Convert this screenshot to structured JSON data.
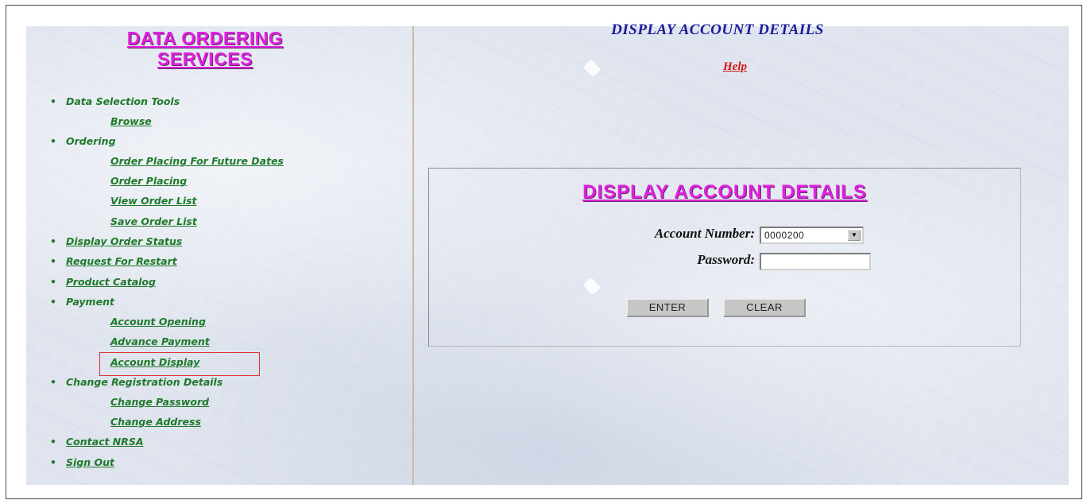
{
  "sidebar": {
    "title": "DATA ORDERING SERVICES",
    "items": [
      {
        "label": "Data Selection Tools",
        "link": false
      },
      {
        "label": "Browse",
        "link": true
      },
      {
        "label": "Ordering",
        "link": false
      },
      {
        "label": "Order Placing For Future Dates",
        "link": true
      },
      {
        "label": "Order Placing",
        "link": true
      },
      {
        "label": "View Order List",
        "link": true
      },
      {
        "label": "Save Order List",
        "link": true
      },
      {
        "label": "Display Order Status",
        "link": true
      },
      {
        "label": "Request For Restart",
        "link": true
      },
      {
        "label": "Product Catalog",
        "link": true
      },
      {
        "label": "Payment",
        "link": false
      },
      {
        "label": "Account Opening",
        "link": true
      },
      {
        "label": "Advance Payment",
        "link": true
      },
      {
        "label": "Account Display",
        "link": true
      },
      {
        "label": "Change Registration Details",
        "link": false
      },
      {
        "label": "Change Password",
        "link": true
      },
      {
        "label": "Change Address",
        "link": true
      },
      {
        "label": "Contact NRSA",
        "link": true
      },
      {
        "label": "Sign Out",
        "link": true
      }
    ],
    "active_item": "Account Display"
  },
  "main": {
    "header": "DISPLAY ACCOUNT DETAILS",
    "help_label": "Help",
    "panel": {
      "title": "DISPLAY ACCOUNT DETAILS",
      "account_number_label": "Account Number:",
      "account_number_value": "0000200",
      "password_label": "Password:",
      "password_value": "",
      "enter_label": "ENTER",
      "clear_label": "CLEAR"
    }
  },
  "colors": {
    "title_magenta": "#e020e0",
    "nav_green": "#1e7a2a",
    "header_blue": "#1a1a9a",
    "help_red": "#d01818",
    "highlight_red": "#e03030"
  }
}
